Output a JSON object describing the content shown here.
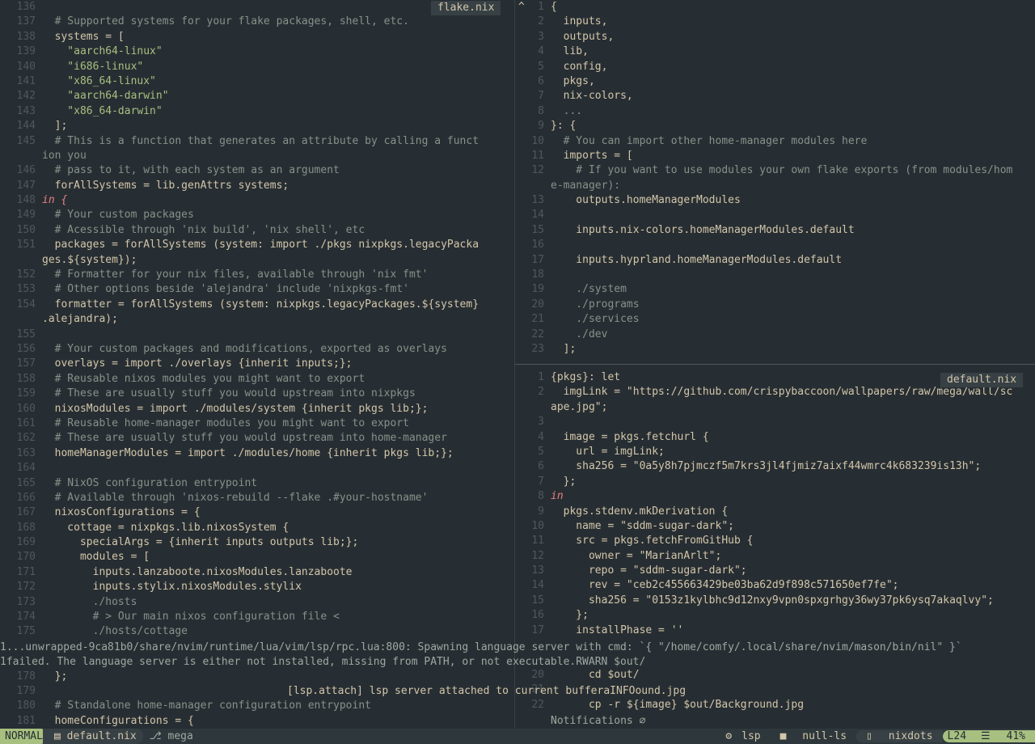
{
  "left_pane": {
    "title": "flake.nix",
    "lines": [
      {
        "n": "136",
        "t": ""
      },
      {
        "n": "137",
        "t": "  # Supported systems for your flake packages, shell, etc.",
        "cls": "c-comment"
      },
      {
        "n": "138",
        "t": "  systems = ["
      },
      {
        "n": "139",
        "t": "    \"aarch64-linux\"",
        "cls": "c-str"
      },
      {
        "n": "140",
        "t": "    \"i686-linux\"",
        "cls": "c-str"
      },
      {
        "n": "141",
        "t": "    \"x86_64-linux\"",
        "cls": "c-str"
      },
      {
        "n": "142",
        "t": "    \"aarch64-darwin\"",
        "cls": "c-str"
      },
      {
        "n": "143",
        "t": "    \"x86_64-darwin\"",
        "cls": "c-str"
      },
      {
        "n": "144",
        "t": "  ];"
      },
      {
        "n": "145",
        "t": "  # This is a function that generates an attribute by calling a funct",
        "cls": "c-comment"
      },
      {
        "n": "",
        "t": "ion you",
        "cls": "c-comment",
        "wrap": true
      },
      {
        "n": "146",
        "t": "  # pass to it, with each system as an argument",
        "cls": "c-comment"
      },
      {
        "n": "147",
        "t": "  forAllSystems = lib.genAttrs systems;"
      },
      {
        "n": "148",
        "t": "in {",
        "cls": "c-kw"
      },
      {
        "n": "149",
        "t": "  # Your custom packages",
        "cls": "c-comment"
      },
      {
        "n": "150",
        "t": "  # Acessible through 'nix build', 'nix shell', etc",
        "cls": "c-comment"
      },
      {
        "n": "151",
        "t": "  packages = forAllSystems (system: import ./pkgs nixpkgs.legacyPacka"
      },
      {
        "n": "",
        "t": "ges.${system});",
        "wrap": true
      },
      {
        "n": "152",
        "t": "  # Formatter for your nix files, available through 'nix fmt'",
        "cls": "c-comment"
      },
      {
        "n": "153",
        "t": "  # Other options beside 'alejandra' include 'nixpkgs-fmt'",
        "cls": "c-comment"
      },
      {
        "n": "154",
        "t": "  formatter = forAllSystems (system: nixpkgs.legacyPackages.${system}"
      },
      {
        "n": "",
        "t": ".alejandra);",
        "wrap": true
      },
      {
        "n": "155",
        "t": ""
      },
      {
        "n": "156",
        "t": "  # Your custom packages and modifications, exported as overlays",
        "cls": "c-comment"
      },
      {
        "n": "157",
        "t": "  overlays = import ./overlays {inherit inputs;};"
      },
      {
        "n": "158",
        "t": "  # Reusable nixos modules you might want to export",
        "cls": "c-comment"
      },
      {
        "n": "159",
        "t": "  # These are usually stuff you would upstream into nixpkgs",
        "cls": "c-comment"
      },
      {
        "n": "160",
        "t": "  nixosModules = import ./modules/system {inherit pkgs lib;};"
      },
      {
        "n": "161",
        "t": "  # Reusable home-manager modules you might want to export",
        "cls": "c-comment"
      },
      {
        "n": "162",
        "t": "  # These are usually stuff you would upstream into home-manager",
        "cls": "c-comment"
      },
      {
        "n": "163",
        "t": "  homeManagerModules = import ./modules/home {inherit pkgs lib;};"
      },
      {
        "n": "164",
        "t": ""
      },
      {
        "n": "165",
        "t": "  # NixOS configuration entrypoint",
        "cls": "c-comment"
      },
      {
        "n": "166",
        "t": "  # Available through 'nixos-rebuild --flake .#your-hostname'",
        "cls": "c-comment"
      },
      {
        "n": "167",
        "t": "  nixosConfigurations = {"
      },
      {
        "n": "168",
        "t": "    cottage = nixpkgs.lib.nixosSystem {"
      },
      {
        "n": "169",
        "t": "      specialArgs = {inherit inputs outputs lib;};"
      },
      {
        "n": "170",
        "t": "      modules = ["
      },
      {
        "n": "171",
        "t": "        inputs.lanzaboote.nixosModules.lanzaboote"
      },
      {
        "n": "172",
        "t": "        inputs.stylix.nixosModules.stylix"
      },
      {
        "n": "173",
        "t": "        ./hosts",
        "cls": "c-comment"
      },
      {
        "n": "174",
        "t": "        # > Our main nixos configuration file <",
        "cls": "c-comment"
      },
      {
        "n": "175",
        "t": "        ./hosts/cottage",
        "cls": "c-comment"
      }
    ],
    "after_msg": [
      {
        "n": "178",
        "t": "  };"
      },
      {
        "n": "179",
        "t": ""
      },
      {
        "n": "180",
        "t": "  # Standalone home-manager configuration entrypoint",
        "cls": "c-comment"
      },
      {
        "n": "181",
        "t": "  homeConfigurations = {"
      }
    ]
  },
  "right_top": {
    "lines": [
      {
        "n": "1",
        "t": "{"
      },
      {
        "n": "2",
        "t": "  inputs,"
      },
      {
        "n": "3",
        "t": "  outputs,"
      },
      {
        "n": "4",
        "t": "  lib,"
      },
      {
        "n": "5",
        "t": "  config,"
      },
      {
        "n": "6",
        "t": "  pkgs,"
      },
      {
        "n": "7",
        "t": "  nix-colors,"
      },
      {
        "n": "8",
        "t": "  ...",
        "cls": "c-comment"
      },
      {
        "n": "9",
        "t": "}: {"
      },
      {
        "n": "10",
        "t": "  # You can import other home-manager modules here",
        "cls": "c-comment"
      },
      {
        "n": "11",
        "t": "  imports = ["
      },
      {
        "n": "12",
        "t": "    # If you want to use modules your own flake exports (from modules/hom",
        "cls": "c-comment"
      },
      {
        "n": "",
        "t": "e-manager):",
        "cls": "c-comment",
        "wrap": true
      },
      {
        "n": "13",
        "t": "    outputs.homeManagerModules"
      },
      {
        "n": "14",
        "t": ""
      },
      {
        "n": "15",
        "t": "    inputs.nix-colors.homeManagerModules.default"
      },
      {
        "n": "16",
        "t": ""
      },
      {
        "n": "17",
        "t": "    inputs.hyprland.homeManagerModules.default"
      },
      {
        "n": "18",
        "t": ""
      },
      {
        "n": "19",
        "t": "    ./system",
        "cls": "c-comment"
      },
      {
        "n": "20",
        "t": "    ./programs",
        "cls": "c-comment"
      },
      {
        "n": "21",
        "t": "    ./services",
        "cls": "c-comment"
      },
      {
        "n": "22",
        "t": "    ./dev",
        "cls": "c-comment"
      },
      {
        "n": "23",
        "t": "  ];"
      }
    ]
  },
  "right_bottom": {
    "title": "default.nix",
    "lines": [
      {
        "n": "1",
        "t": "{pkgs}: let"
      },
      {
        "n": "2",
        "t": "  imgLink = \"https://github.com/crispybaccoon/wallpapers/raw/mega/wall/sc"
      },
      {
        "n": "",
        "t": "ape.jpg\";",
        "wrap": true
      },
      {
        "n": "3",
        "t": ""
      },
      {
        "n": "4",
        "t": "  image = pkgs.fetchurl {"
      },
      {
        "n": "5",
        "t": "    url = imgLink;"
      },
      {
        "n": "6",
        "t": "    sha256 = \"0a5y8h7pjmczf5m7krs3jl4fjmiz7aixf44wmrc4k683239is13h\";"
      },
      {
        "n": "7",
        "t": "  };"
      },
      {
        "n": "8",
        "t": "in",
        "cls": "c-kw"
      },
      {
        "n": "9",
        "t": "  pkgs.stdenv.mkDerivation {"
      },
      {
        "n": "10",
        "t": "    name = \"sddm-sugar-dark\";"
      },
      {
        "n": "11",
        "t": "    src = pkgs.fetchFromGitHub {"
      },
      {
        "n": "12",
        "t": "      owner = \"MarianArlt\";"
      },
      {
        "n": "13",
        "t": "      repo = \"sddm-sugar-dark\";"
      },
      {
        "n": "14",
        "t": "      rev = \"ceb2c455663429be03ba62d9f898c571650ef7fe\";"
      },
      {
        "n": "15",
        "t": "      sha256 = \"0153z1kylbhc9d12nxy9vpn0spxgrhgy36wy37pk6ysq7akaqlvy\";"
      },
      {
        "n": "16",
        "t": "    };"
      },
      {
        "n": "17",
        "t": "    installPhase = ''"
      }
    ],
    "after_msg": [
      {
        "n": "20",
        "t": "      cd $out/"
      },
      {
        "n": "21",
        "t": ""
      },
      {
        "n": "22",
        "t": "      cp -r ${image} $out/Background.jpg"
      }
    ]
  },
  "messages": {
    "line1": "1...unwrapped-9ca81b0/share/nvim/runtime/lua/vim/lsp/rpc.lua:800: Spawning language server with cmd: `{ \"/home/comfy/.local/share/nvim/mason/bin/nil\" }`",
    "line2": "1failed. The language server is either not installed, missing from PATH, or not executable.RWARN $out/",
    "lsp_attach": "[lsp.attach] lsp server attached to current bufferaINFOound.jpg",
    "notifications": "Notifications ∅"
  },
  "statusline": {
    "mode": "NORMAL",
    "file": "default.nix",
    "branch": "mega",
    "lsp": "lsp",
    "nullls": "null-ls",
    "project": "nixdots",
    "line": "L24",
    "percent": "41%"
  },
  "colors": {
    "bg": "#272e33",
    "accent": "#a7c080",
    "comment": "#859289",
    "keyword": "#e67e80",
    "string": "#a7c080"
  }
}
